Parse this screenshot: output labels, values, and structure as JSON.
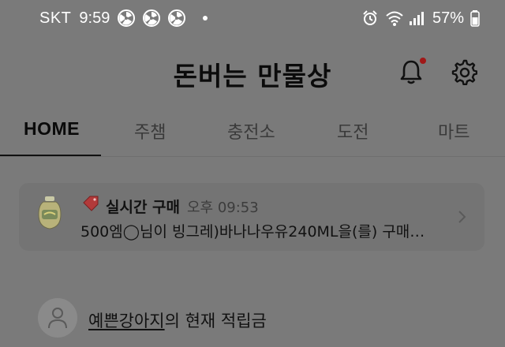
{
  "status_bar": {
    "carrier": "SKT",
    "time": "9:59",
    "battery": "57%",
    "icons": [
      "fan-icon",
      "fan-icon",
      "fan-icon",
      "alarm-icon",
      "wifi-icon",
      "signal-icon",
      "battery-icon"
    ]
  },
  "header": {
    "title": "돈버는 만물상",
    "bell_icon": "bell-icon",
    "settings_icon": "gear-icon",
    "notification_dot_color": "#a01818"
  },
  "tabs": [
    {
      "label": "HOME",
      "active": true
    },
    {
      "label": "주챔",
      "active": false
    },
    {
      "label": "충전소",
      "active": false
    },
    {
      "label": "도전",
      "active": false
    },
    {
      "label": "마트",
      "active": false
    }
  ],
  "live_purchase": {
    "title": "실시간 구매",
    "time": "오후 09:53",
    "message": "500엠◯님이 빙그레)바나나우유240ML을(를) 구매…",
    "product_icon": "banana-milk-icon",
    "tag_icon": "tag-icon",
    "chevron_icon": "chevron-right-icon"
  },
  "points": {
    "username": "예쁜강아지",
    "suffix": "의 현재 적립금",
    "avatar_icon": "user-icon"
  },
  "colors": {
    "background": "#7a7a7a",
    "card": "#747474",
    "text": "#111111"
  }
}
